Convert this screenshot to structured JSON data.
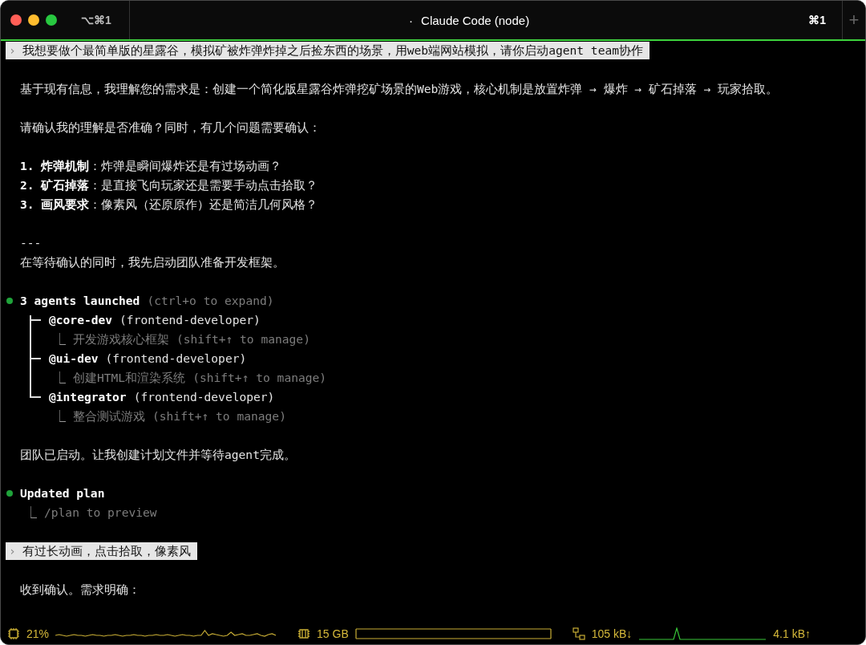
{
  "window": {
    "title_dot": "·",
    "title": "Claude Code (node)",
    "tab_shortcut": "⌥⌘1",
    "window_shortcut": "⌘1",
    "new_tab_symbol": "+"
  },
  "transcript": [
    {
      "kind": "prompt",
      "symbol": "›",
      "text": "我想要做个最简单版的星露谷，模拟矿被炸弹炸掉之后捡东西的场景，用web端网站模拟，请你启动agent team协作"
    },
    {
      "kind": "paragraph",
      "lines": [
        "基于现有信息，我理解您的需求是：创建一个简化版星露谷炸弹挖矿场景的Web游戏，核心机制是放置炸弹 → 爆炸 → 矿石掉落 → 玩家拾取。"
      ]
    },
    {
      "kind": "paragraph",
      "lines": [
        "请确认我的理解是否准确？同时，有几个问题需要确认："
      ]
    },
    {
      "kind": "paragraph",
      "lines": [
        "**1. 炸弹机制**：炸弹是瞬间爆炸还是有过场动画？",
        "**2. 矿石掉落**：是直接飞向玩家还是需要手动点击拾取？",
        "**3. 画风要求**：像素风（还原原作）还是简洁几何风格？"
      ]
    },
    {
      "kind": "paragraph",
      "lines": [
        "---",
        "在等待确认的同时，我先启动团队准备开发框架。"
      ]
    },
    {
      "kind": "status",
      "title": "3 agents launched",
      "hint": "(ctrl+o to expand)",
      "agents": [
        {
          "name": "@core-dev",
          "role": "(frontend-developer)",
          "sub_symbol": "⎿",
          "task": "开发游戏核心框架",
          "task_hint": "(shift+↑ to manage)"
        },
        {
          "name": "@ui-dev",
          "role": "(frontend-developer)",
          "sub_symbol": "⎿",
          "task": "创建HTML和渲染系统",
          "task_hint": "(shift+↑ to manage)"
        },
        {
          "name": "@integrator",
          "role": "(frontend-developer)",
          "sub_symbol": "⎿",
          "task": "整合测试游戏",
          "task_hint": "(shift+↑ to manage)"
        }
      ]
    },
    {
      "kind": "paragraph",
      "lines": [
        "团队已启动。让我创建计划文件并等待agent完成。"
      ]
    },
    {
      "kind": "status",
      "title": "Updated plan",
      "details": [
        {
          "symbol": "⎿",
          "text": "/plan to preview"
        }
      ]
    },
    {
      "kind": "prompt",
      "symbol": "›",
      "text": "有过长动画，点击拾取，像素风"
    },
    {
      "kind": "paragraph",
      "lines": [
        "收到确认。需求明确："
      ]
    }
  ],
  "status_bar": {
    "cpu": "21%",
    "memory": "15 GB",
    "download": "105 kB↓",
    "upload": "4.1 kB↑"
  }
}
